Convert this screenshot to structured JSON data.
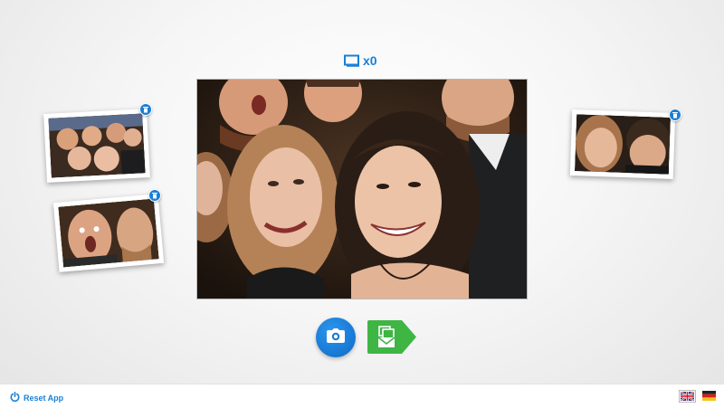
{
  "counter": {
    "icon": "frame-icon",
    "value": "x0"
  },
  "main_photo": {
    "description_icon": "photo-preview"
  },
  "thumbnails": [
    {
      "icon": "trash-icon"
    },
    {
      "icon": "trash-icon"
    },
    {
      "icon": "trash-icon"
    }
  ],
  "actions": {
    "capture_icon": "camera-icon",
    "send_icon": "photos-send-icon"
  },
  "footer": {
    "reset_label": "Reset App",
    "reset_icon": "power-icon"
  },
  "languages": [
    {
      "icon": "uk-flag-icon"
    },
    {
      "icon": "de-flag-icon"
    }
  ],
  "colors": {
    "accent": "#1a7fd6",
    "send_green": "#3fb544",
    "background": "#f2f2f2"
  }
}
